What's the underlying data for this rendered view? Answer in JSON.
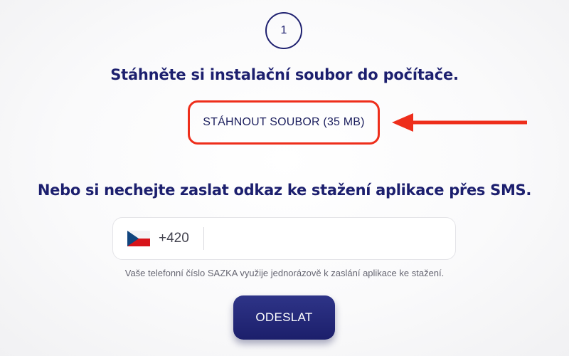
{
  "step": {
    "number": "1"
  },
  "download_section": {
    "heading": "Stáhněte si instalační soubor do počítače.",
    "button_label": "STÁHNOUT SOUBOR (35 MB)",
    "highlight_color": "#ee2e1b"
  },
  "sms_section": {
    "heading": "Nebo si nechejte zaslat odkaz ke stažení aplikace přes SMS.",
    "phone": {
      "flag_icon": "czech-flag-icon",
      "country_code": "+420",
      "value": ""
    },
    "helper_text": "Vaše telefonní číslo SAZKA využije jednorázově k zaslání aplikace ke stažení.",
    "send_label": "ODESLAT"
  },
  "colors": {
    "primary": "#1c1f6e",
    "accent_red": "#ee2e1b",
    "button_gradient_top": "#2e3488",
    "button_gradient_bottom": "#1c1f6b"
  }
}
